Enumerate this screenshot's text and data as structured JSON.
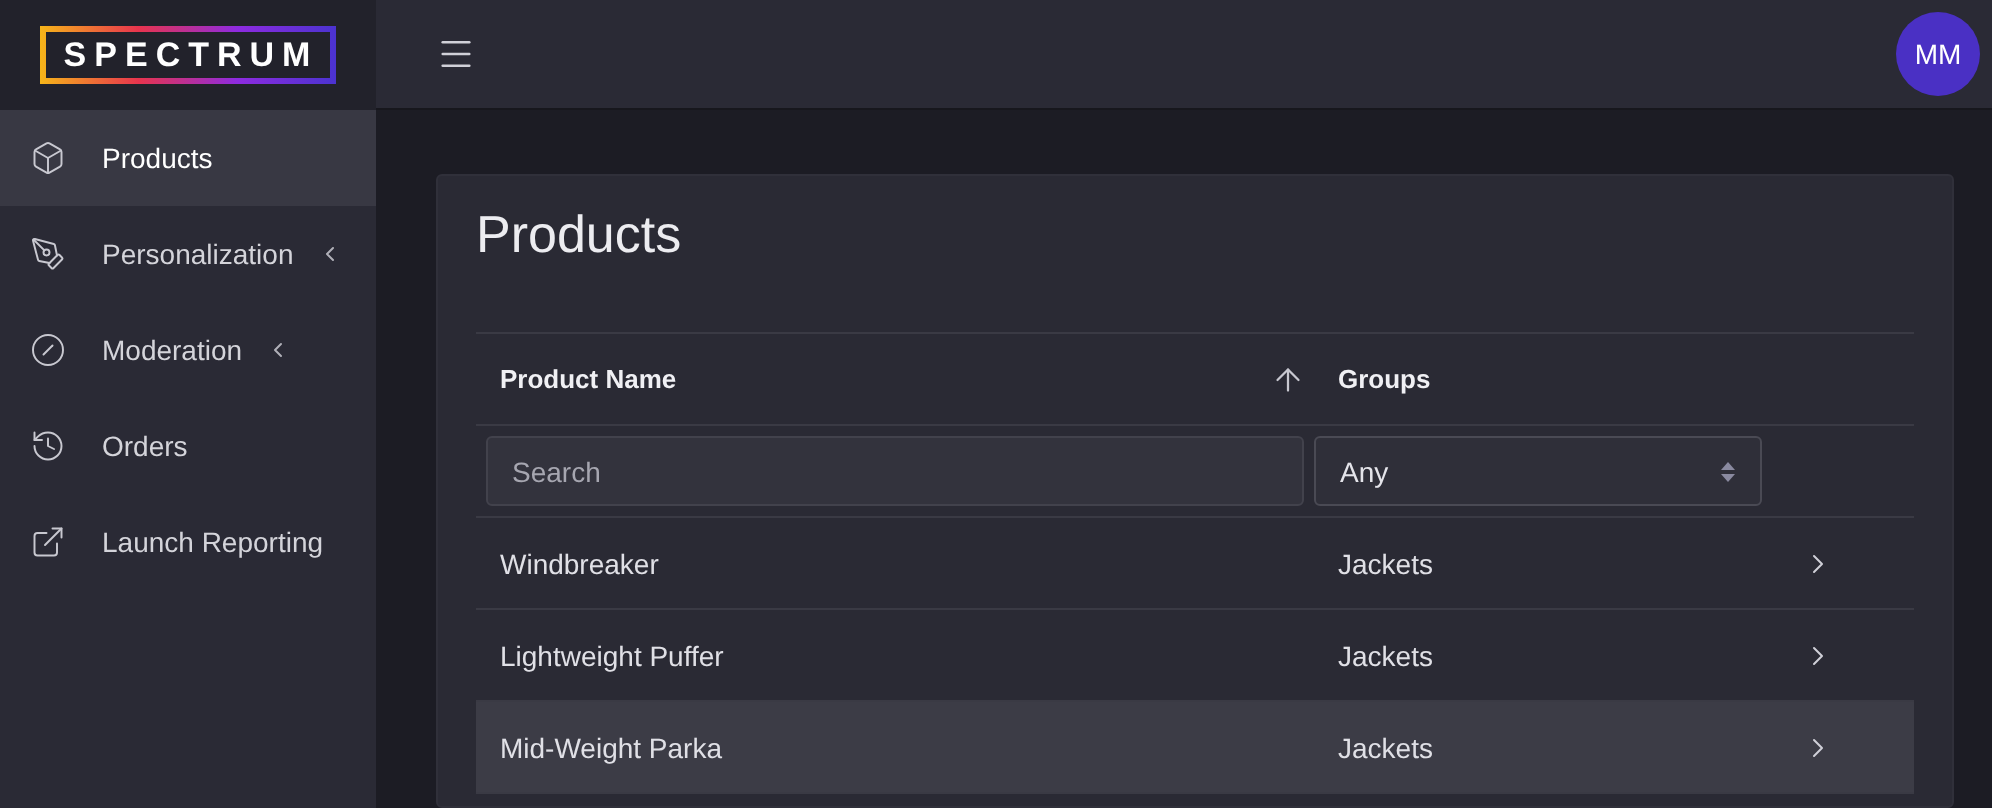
{
  "logo": {
    "text": "SPECTRUM"
  },
  "sidebar": {
    "items": [
      {
        "label": "Products",
        "selected": true,
        "expandable": false
      },
      {
        "label": "Personalization",
        "selected": false,
        "expandable": true
      },
      {
        "label": "Moderation",
        "selected": false,
        "expandable": true
      },
      {
        "label": "Orders",
        "selected": false,
        "expandable": false
      },
      {
        "label": "Launch Reporting",
        "selected": false,
        "expandable": false
      }
    ]
  },
  "header": {
    "avatar": "MM"
  },
  "page": {
    "title": "Products"
  },
  "table": {
    "columns": [
      {
        "label": "Product Name",
        "sorted": true
      },
      {
        "label": "Groups",
        "sorted": false
      }
    ],
    "filters": {
      "search": {
        "placeholder": "Search"
      },
      "group": {
        "value": "Any"
      }
    },
    "rows": [
      {
        "name": "Windbreaker",
        "group": "Jackets",
        "selected": false
      },
      {
        "name": "Lightweight Puffer",
        "group": "Jackets",
        "selected": false
      },
      {
        "name": "Mid-Weight Parka",
        "group": "Jackets",
        "selected": true
      }
    ]
  }
}
